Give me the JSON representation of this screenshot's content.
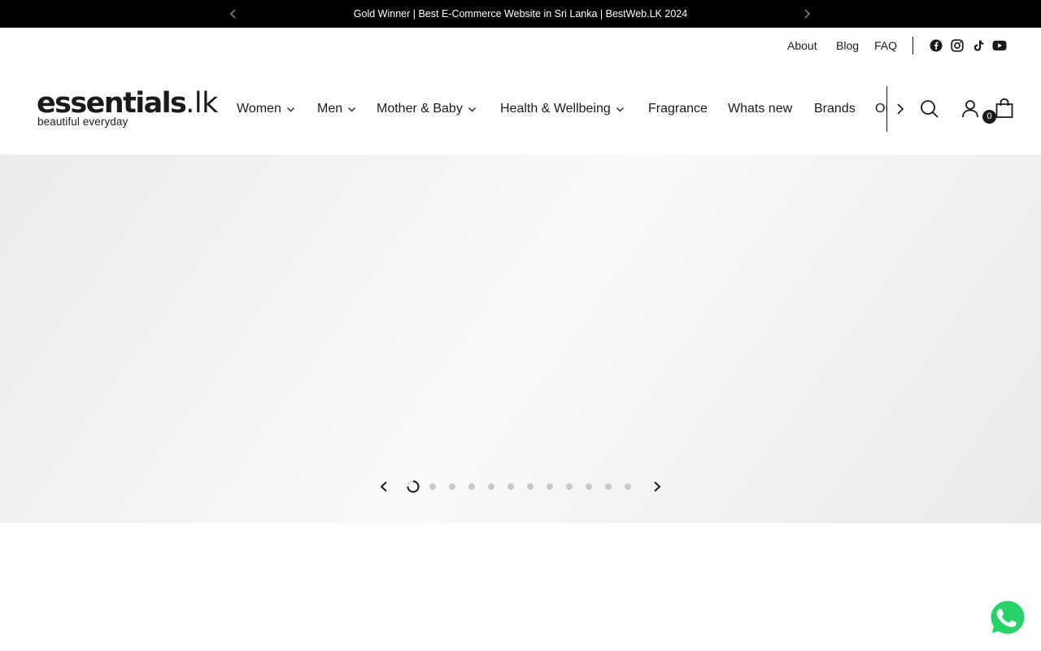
{
  "announcement": {
    "message": "Gold Winner | Best E-Commerce Website in Sri Lanka | BestWeb.LK 2024",
    "prev_icon": "chevron-left-icon",
    "next_icon": "chevron-right-icon"
  },
  "utility_nav": {
    "links": [
      "About",
      "Blog",
      "FAQ"
    ],
    "social": [
      "facebook-icon",
      "instagram-icon",
      "tiktok-icon",
      "youtube-icon"
    ]
  },
  "logo": {
    "brand_main": "ess",
    "brand_e": "e",
    "brand_rest": "ntials",
    "brand_suffix": ".lk",
    "tagline": "beautiful everyday"
  },
  "main_nav": {
    "items": [
      {
        "label": "Women",
        "has_dropdown": true
      },
      {
        "label": "Men",
        "has_dropdown": true
      },
      {
        "label": "Mother & Baby",
        "has_dropdown": true
      },
      {
        "label": "Health & Wellbeing",
        "has_dropdown": true
      },
      {
        "label": "Fragrance",
        "has_dropdown": false
      },
      {
        "label": "Whats new",
        "has_dropdown": false
      },
      {
        "label": "Brands",
        "has_dropdown": false
      },
      {
        "label": "Our Stores",
        "has_dropdown": false
      }
    ]
  },
  "header_actions": {
    "search_icon": "search-icon",
    "account_icon": "account-icon",
    "cart_icon": "shopping-bag-icon",
    "cart_count": "0"
  },
  "slideshow": {
    "slide_count": 12,
    "active_index": 0,
    "prev_icon": "arrow-left-icon",
    "next_icon": "arrow-right-icon"
  },
  "whatsapp": {
    "icon": "whatsapp-icon",
    "color": "#25d366"
  },
  "colors": {
    "announcement_bg": "#000000",
    "text": "#1a1a1a"
  }
}
